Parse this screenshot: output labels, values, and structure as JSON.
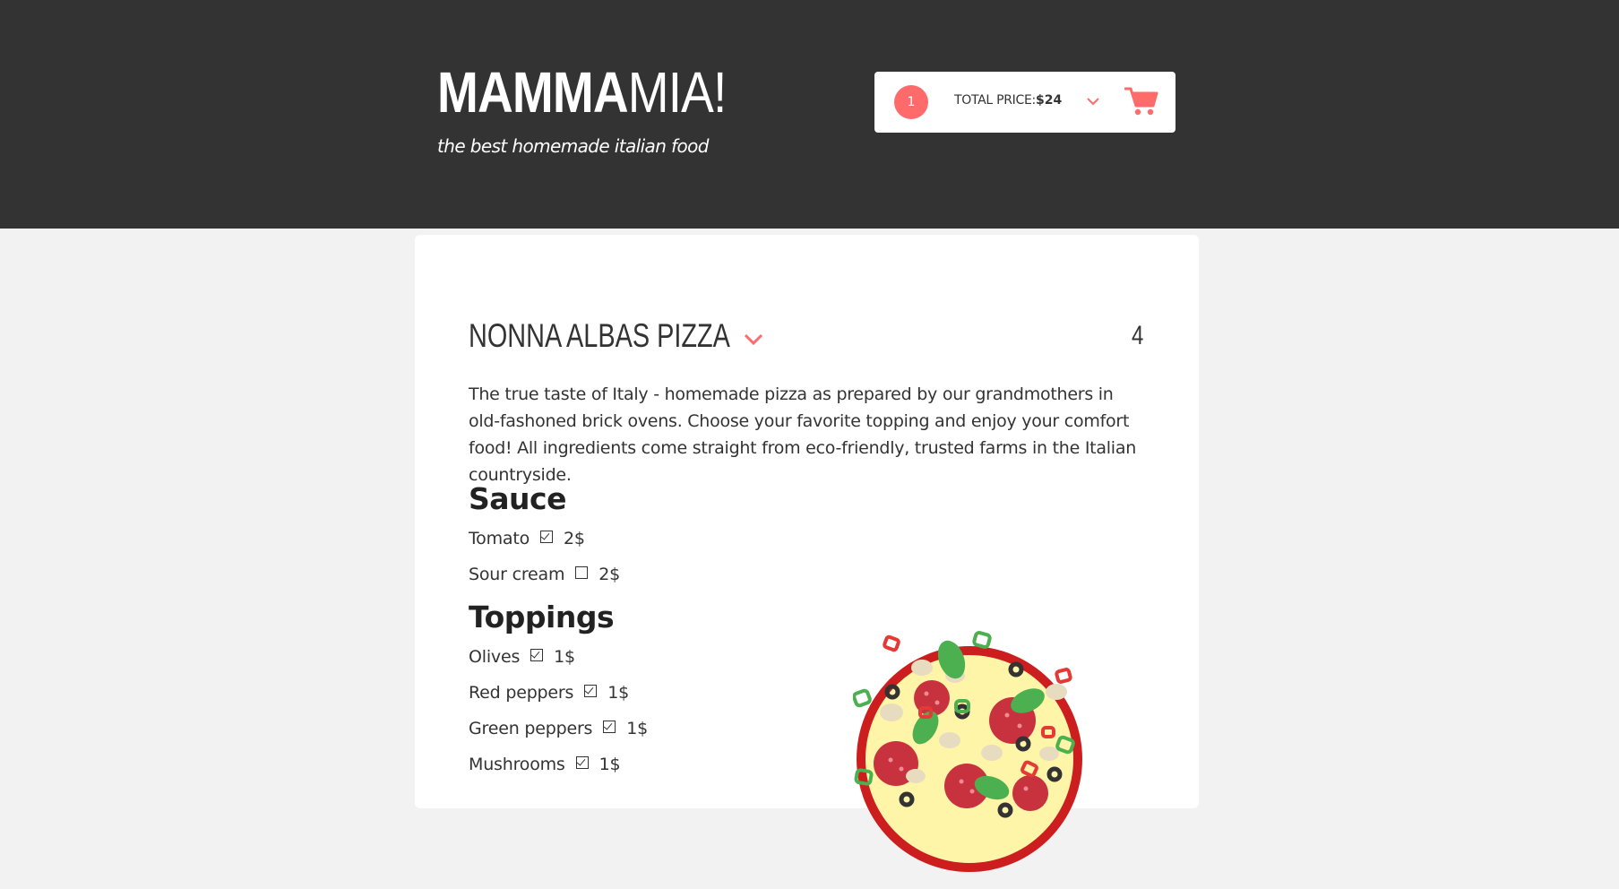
{
  "header": {
    "logo_bold": "MAMMA",
    "logo_light": "MIA!",
    "tagline": "the best homemade italian food"
  },
  "cart": {
    "count": "1",
    "total_label": "TOTAL PRICE:",
    "total_value": "$24",
    "icons": {
      "toggle": "chevron-down-icon",
      "cart": "cart-icon"
    },
    "accent_color": "#ff6b6b"
  },
  "product": {
    "title": "NONNA ALBAS PIZZA",
    "count": "4",
    "description": "The true taste of Italy - homemade pizza as prepared by our grandmothers in old-fashoned brick ovens. Choose your favorite topping and enjoy your comfort food! All ingredients come straight from eco-friendly, trusted farms in the Italian countryside.",
    "sauce": {
      "heading": "Sauce",
      "options": [
        {
          "name": "Tomato",
          "price": "2$",
          "checked": true
        },
        {
          "name": "Sour cream",
          "price": "2$",
          "checked": false
        }
      ]
    },
    "toppings": {
      "heading": "Toppings",
      "options": [
        {
          "name": "Olives",
          "price": "1$",
          "checked": true
        },
        {
          "name": "Red peppers",
          "price": "1$",
          "checked": true
        },
        {
          "name": "Green peppers",
          "price": "1$",
          "checked": true
        },
        {
          "name": "Mushrooms",
          "price": "1$",
          "checked": true
        }
      ]
    }
  }
}
